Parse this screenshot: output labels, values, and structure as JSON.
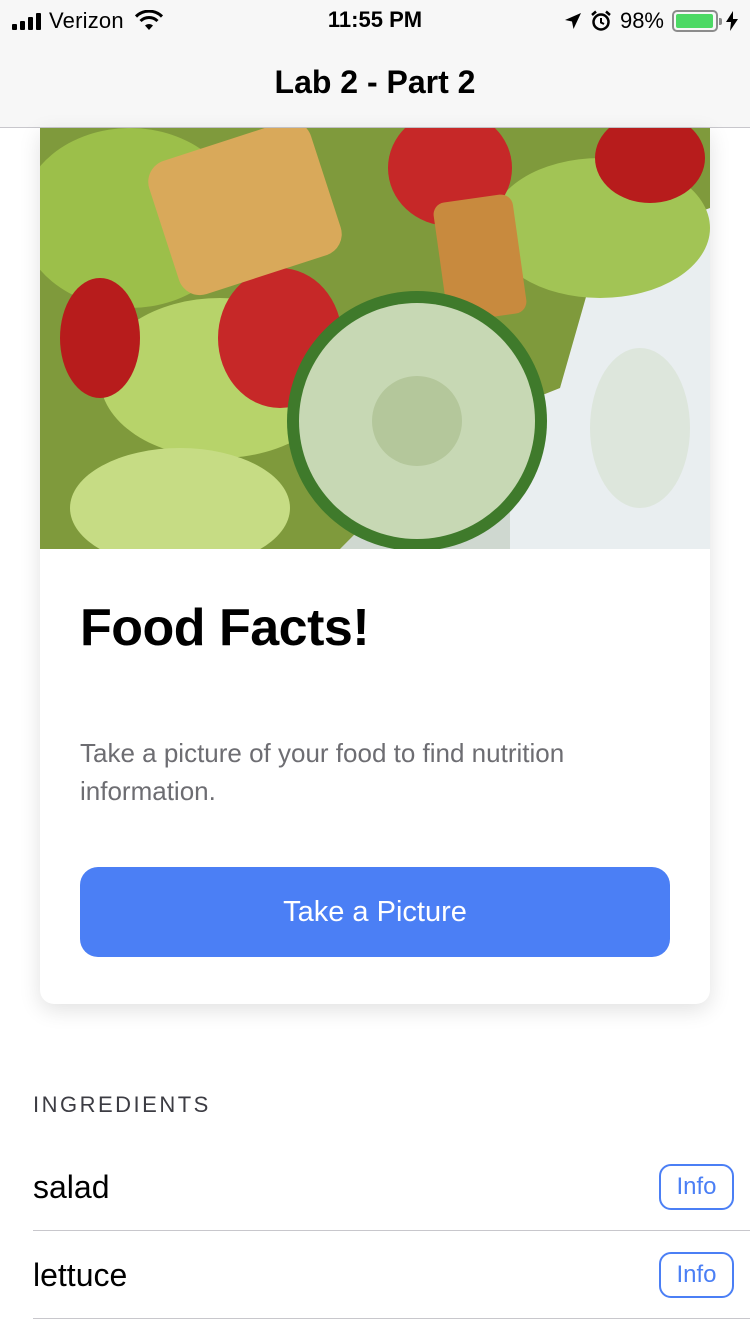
{
  "status_bar": {
    "carrier": "Verizon",
    "time": "11:55 PM",
    "battery_percent": "98%",
    "battery_level": 0.98,
    "icons": [
      "signal-icon",
      "wifi-icon",
      "location-arrow-icon",
      "alarm-icon",
      "battery-icon",
      "charging-bolt-icon"
    ]
  },
  "nav": {
    "title": "Lab 2 - Part 2"
  },
  "card": {
    "image": "salad-photo",
    "title": "Food Facts!",
    "description": "Take a picture of your food to find nutrition information.",
    "button_label": "Take a Picture"
  },
  "ingredients": {
    "header": "INGREDIENTS",
    "items": [
      {
        "name": "salad",
        "button_label": "Info"
      },
      {
        "name": "lettuce",
        "button_label": "Info"
      }
    ]
  },
  "colors": {
    "accent": "#4b7ff5",
    "battery": "#4cd964",
    "secondary_text": "#6d6d72"
  }
}
